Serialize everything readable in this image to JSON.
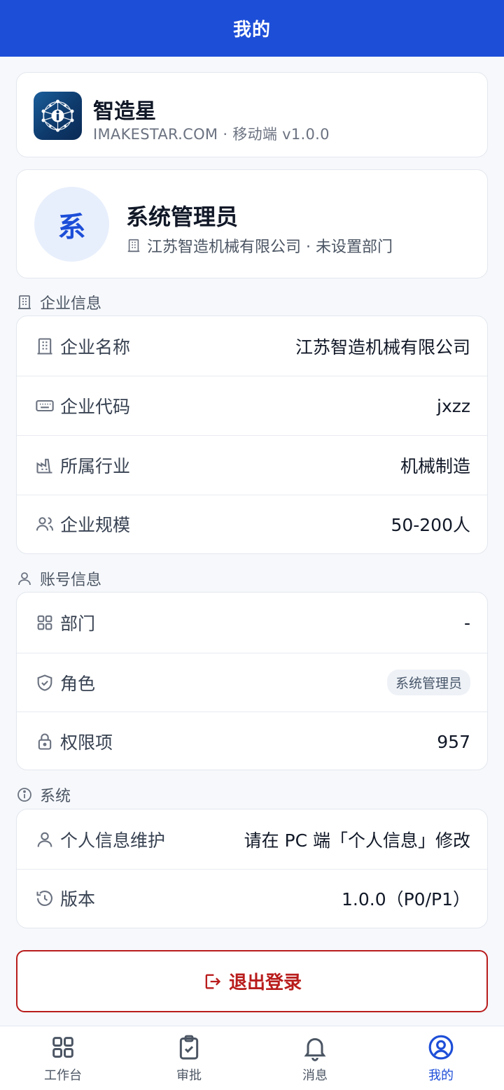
{
  "header": {
    "title": "我的"
  },
  "brand": {
    "name": "智造星",
    "subtitle": "IMAKESTAR.COM · 移动端 v1.0.0",
    "logo_icon": "network-logo-icon"
  },
  "user": {
    "avatar_char": "系",
    "name": "系统管理员",
    "org": "江苏智造机械有限公司 · 未设置部门"
  },
  "sections": {
    "enterprise": {
      "label": "企业信息",
      "rows": [
        {
          "label": "企业名称",
          "value": "江苏智造机械有限公司",
          "icon": "building-icon"
        },
        {
          "label": "企业代码",
          "value": "jxzz",
          "icon": "keyboard-icon"
        },
        {
          "label": "所属行业",
          "value": "机械制造",
          "icon": "factory-icon"
        },
        {
          "label": "企业规模",
          "value": "50-200人",
          "icon": "users-icon"
        }
      ]
    },
    "account": {
      "label": "账号信息",
      "rows": [
        {
          "label": "部门",
          "value": "-",
          "icon": "grid-icon"
        },
        {
          "label": "角色",
          "value": "系统管理员",
          "icon": "shield-check-icon"
        },
        {
          "label": "权限项",
          "value": "957",
          "icon": "lock-icon"
        }
      ]
    },
    "system": {
      "label": "系统",
      "rows": [
        {
          "label": "个人信息维护",
          "value": "请在 PC 端「个人信息」修改",
          "icon": "user-icon"
        },
        {
          "label": "版本",
          "value": "1.0.0（P0/P1）",
          "icon": "history-icon"
        }
      ]
    }
  },
  "logout": {
    "label": "退出登录"
  },
  "tabs": [
    {
      "label": "工作台",
      "icon": "grid-icon"
    },
    {
      "label": "审批",
      "icon": "clipboard-check-icon"
    },
    {
      "label": "消息",
      "icon": "bell-icon"
    },
    {
      "label": "我的",
      "icon": "user-circle-icon",
      "active": true
    }
  ],
  "colors": {
    "primary": "#1d4ed8",
    "danger": "#b91c1c",
    "background": "#f6f8fb"
  }
}
